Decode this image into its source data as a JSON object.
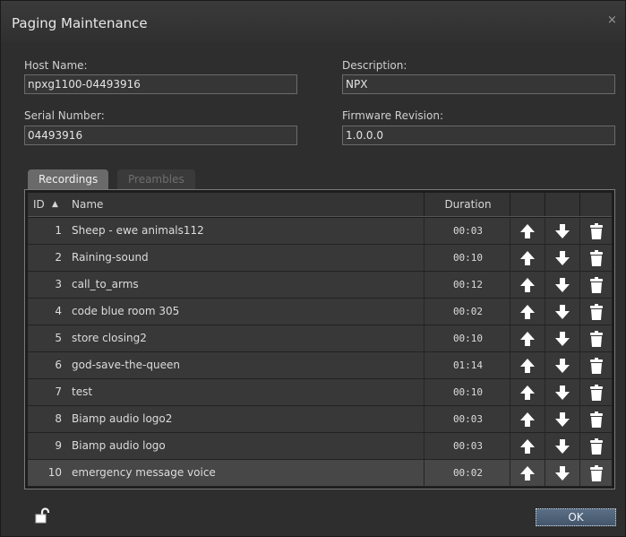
{
  "window": {
    "title": "Paging Maintenance",
    "close_glyph": "×"
  },
  "host_name": {
    "label": "Host Name:",
    "value": "npxg1100-04493916"
  },
  "description": {
    "label": "Description:",
    "value": "NPX"
  },
  "serial_number": {
    "label": "Serial Number:",
    "value": "04493916"
  },
  "firmware_revision": {
    "label": "Firmware Revision:",
    "value": "1.0.0.0"
  },
  "tabs": [
    {
      "label": "Recordings",
      "active": true
    },
    {
      "label": "Preambles",
      "active": false
    }
  ],
  "grid": {
    "columns": {
      "id": "ID",
      "sort_glyph": "▲",
      "name": "Name",
      "duration": "Duration"
    },
    "rows": [
      {
        "id": "1",
        "name": "Sheep - ewe animals112",
        "duration": "00:03"
      },
      {
        "id": "2",
        "name": "Raining-sound",
        "duration": "00:10"
      },
      {
        "id": "3",
        "name": "call_to_arms",
        "duration": "00:12"
      },
      {
        "id": "4",
        "name": "code blue room 305",
        "duration": "00:02"
      },
      {
        "id": "5",
        "name": "store closing2",
        "duration": "00:10"
      },
      {
        "id": "6",
        "name": "god-save-the-queen",
        "duration": "01:14"
      },
      {
        "id": "7",
        "name": "test",
        "duration": "00:10"
      },
      {
        "id": "8",
        "name": "Biamp audio logo2",
        "duration": "00:03"
      },
      {
        "id": "9",
        "name": "Biamp audio logo",
        "duration": "00:03"
      },
      {
        "id": "10",
        "name": "emergency message voice",
        "duration": "00:02"
      }
    ],
    "selected_row_index": 9
  },
  "icons": {
    "move_up": "arrow-up-icon",
    "move_down": "arrow-down-icon",
    "delete": "trash-icon",
    "lock": "unlocked-padlock-icon"
  },
  "footer": {
    "ok_label": "OK"
  },
  "colors": {
    "background": "#2e2e2e",
    "active_tab": "#6a6a6a",
    "ok_button": "#4f6378"
  }
}
